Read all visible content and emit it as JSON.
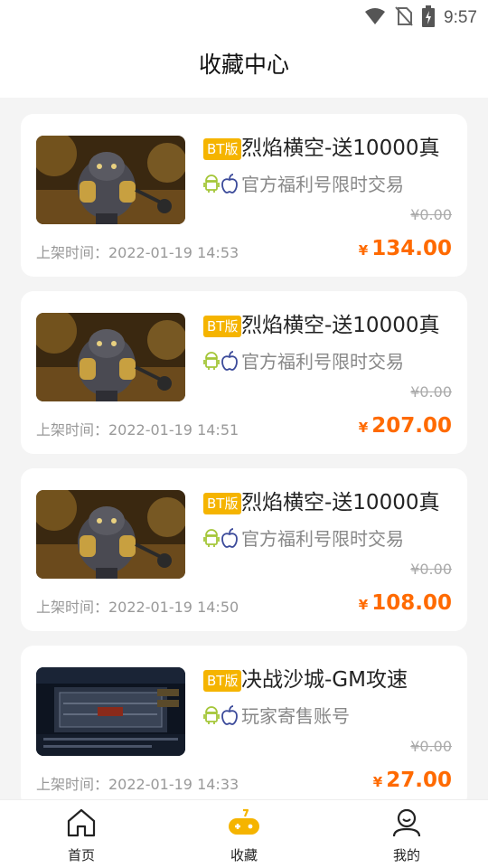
{
  "status_bar": {
    "time": "9:57",
    "icons": [
      "wifi-icon",
      "no-sim-icon",
      "battery-icon"
    ]
  },
  "header": {
    "title": "收藏中心"
  },
  "items": [
    {
      "tag": "BT版",
      "title": "烈焰横空-送10000真",
      "subtitle": "官方福利号限时交易",
      "old_price": "¥0.00",
      "time_label": "上架时间：2022-01-19 14:53",
      "currency": "¥",
      "price": "134.00",
      "thumb": "warrior"
    },
    {
      "tag": "BT版",
      "title": "烈焰横空-送10000真",
      "subtitle": "官方福利号限时交易",
      "old_price": "¥0.00",
      "time_label": "上架时间：2022-01-19 14:51",
      "currency": "¥",
      "price": "207.00",
      "thumb": "warrior"
    },
    {
      "tag": "BT版",
      "title": "烈焰横空-送10000真",
      "subtitle": "官方福利号限时交易",
      "old_price": "¥0.00",
      "time_label": "上架时间：2022-01-19 14:50",
      "currency": "¥",
      "price": "108.00",
      "thumb": "warrior"
    },
    {
      "tag": "BT版",
      "title": "决战沙城-GM攻速",
      "subtitle": "玩家寄售账号",
      "old_price": "¥0.00",
      "time_label": "上架时间：2022-01-19 14:33",
      "currency": "¥",
      "price": "27.00",
      "thumb": "castle"
    }
  ],
  "nav": [
    {
      "label": "首页",
      "icon": "home-icon",
      "active": false
    },
    {
      "label": "收藏",
      "icon": "gamepad-icon",
      "active": true
    },
    {
      "label": "我的",
      "icon": "user-icon",
      "active": false
    }
  ],
  "colors": {
    "accent": "#ff6a00",
    "tag": "#f5b400",
    "android": "#a4c639",
    "apple": "#3b4a9a",
    "nav_active": "#f5b400"
  }
}
